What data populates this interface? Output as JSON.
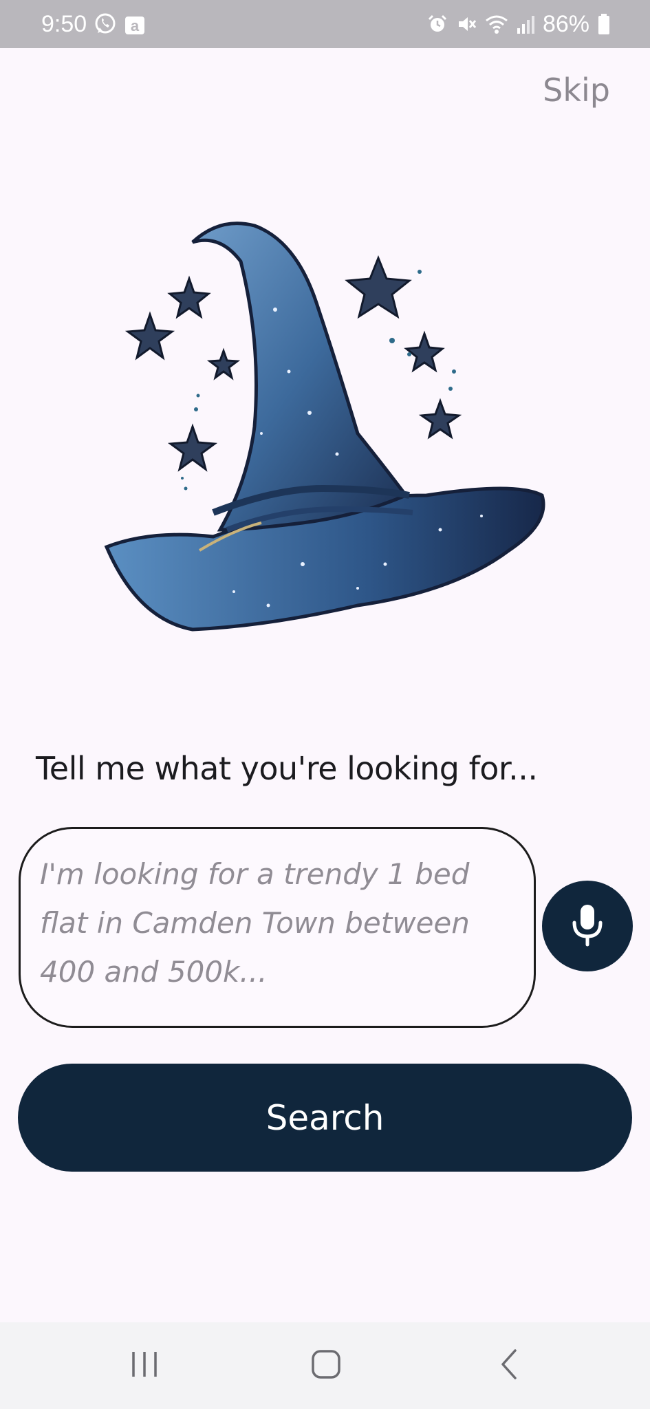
{
  "status_bar": {
    "time": "9:50",
    "battery": "86%",
    "left_icons": [
      "whatsapp-icon",
      "amazon-icon"
    ],
    "right_icons": [
      "alarm-icon",
      "mute-icon",
      "wifi-icon",
      "signal-icon",
      "battery-icon"
    ]
  },
  "header": {
    "skip_label": "Skip"
  },
  "hero": {
    "image": "wizard-hat-with-stars",
    "hat_color": "#3d6a9c",
    "star_color": "#2f3f5c"
  },
  "prompt": {
    "label": "Tell me what you're looking for..."
  },
  "query": {
    "value": "",
    "placeholder": "I'm looking for a trendy 1 bed flat in Camden Town between 400 and 500k..."
  },
  "mic": {
    "icon": "microphone-icon"
  },
  "search": {
    "label": "Search"
  },
  "nav_bar": {
    "buttons": [
      "recent-apps-icon",
      "home-icon",
      "back-icon"
    ]
  },
  "colors": {
    "background": "#fcf7fd",
    "primary": "#10263c",
    "status_bar": "#b9b7bc",
    "muted_text": "#8c8890"
  }
}
